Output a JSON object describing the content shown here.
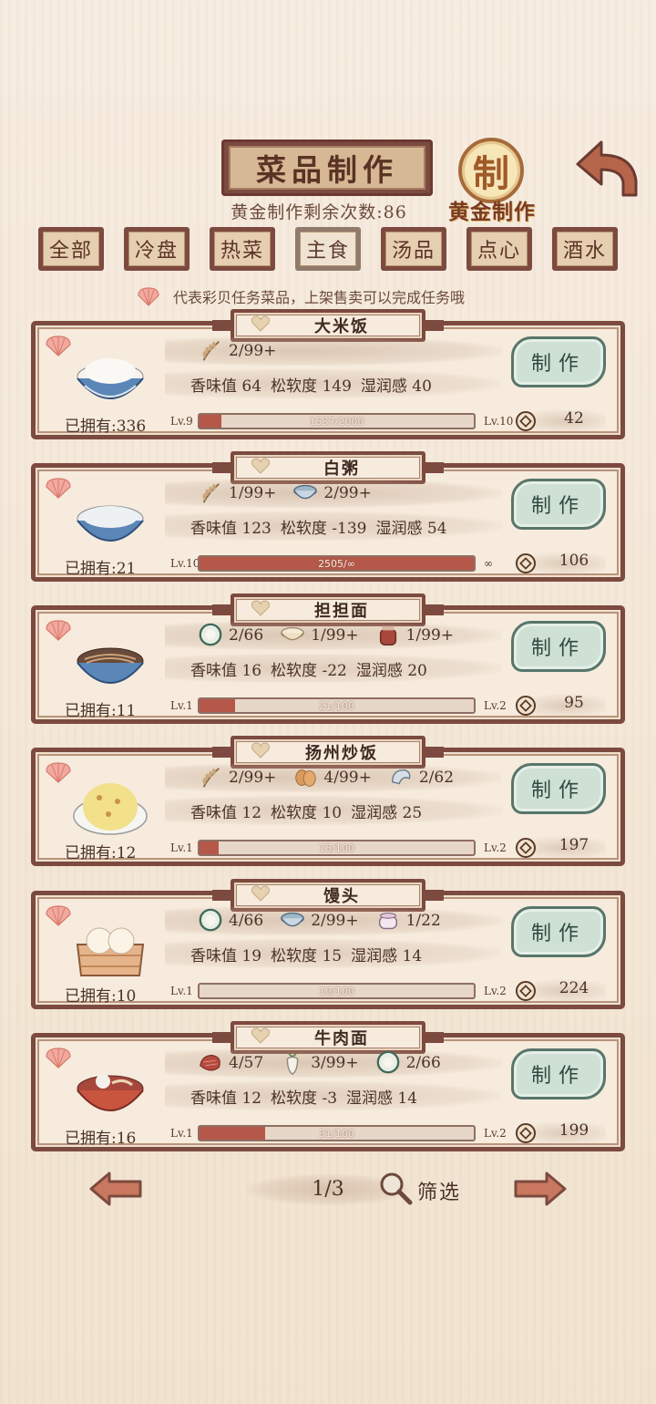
{
  "header": {
    "title": "菜品制作",
    "gold_count": "黄金制作剩余次数:86",
    "gold_seal_char": "制",
    "gold_label": "黄金制作"
  },
  "tabs": [
    {
      "label": "全部",
      "active": false
    },
    {
      "label": "冷盘",
      "active": false
    },
    {
      "label": "热菜",
      "active": false
    },
    {
      "label": "主食",
      "active": true
    },
    {
      "label": "汤品",
      "active": false
    },
    {
      "label": "点心",
      "active": false
    },
    {
      "label": "酒水",
      "active": false
    }
  ],
  "hint": "代表彩贝任务菜品，上架售卖可以完成任务哦",
  "make_label": "制作",
  "dishes": [
    {
      "name": "大米饭",
      "owned": "已拥有:336",
      "ingredients": [
        {
          "icon": "rice-stalk-icon",
          "count": "2/99+"
        }
      ],
      "stats": [
        "香味值 64",
        "松软度 149",
        "湿润感 40"
      ],
      "lv_left": "Lv.9",
      "lv_right": "Lv.10",
      "progress_text": "1537/2000",
      "progress": 0.077,
      "price": "42",
      "dish_icon": "rice-bowl-icon"
    },
    {
      "name": "白粥",
      "owned": "已拥有:21",
      "ingredients": [
        {
          "icon": "rice-stalk-icon",
          "count": "1/99+"
        },
        {
          "icon": "water-bowl-icon",
          "count": "2/99+"
        }
      ],
      "stats": [
        "香味值 123",
        "松软度 -139",
        "湿润感 54"
      ],
      "lv_left": "Lv.10",
      "lv_right": "∞",
      "progress_text": "2505/∞",
      "progress": 1.0,
      "price": "106",
      "dish_icon": "porridge-bowl-icon"
    },
    {
      "name": "担担面",
      "owned": "已拥有:11",
      "ingredients": [
        {
          "icon": "dough-plate-icon",
          "count": "2/66"
        },
        {
          "icon": "flour-bowl-icon",
          "count": "1/99+"
        },
        {
          "icon": "chili-jar-icon",
          "count": "1/99+"
        }
      ],
      "stats": [
        "香味值 16",
        "松软度 -22",
        "湿润感 20"
      ],
      "lv_left": "Lv.1",
      "lv_right": "Lv.2",
      "progress_text": "21/100",
      "progress": 0.13,
      "price": "95",
      "dish_icon": "noodle-bowl-icon"
    },
    {
      "name": "扬州炒饭",
      "owned": "已拥有:12",
      "ingredients": [
        {
          "icon": "rice-stalk-icon",
          "count": "2/99+"
        },
        {
          "icon": "egg-icon",
          "count": "4/99+"
        },
        {
          "icon": "shrimp-icon",
          "count": "2/62"
        }
      ],
      "stats": [
        "香味值 12",
        "松软度 10",
        "湿润感 25"
      ],
      "lv_left": "Lv.1",
      "lv_right": "Lv.2",
      "progress_text": "15/100",
      "progress": 0.07,
      "price": "197",
      "dish_icon": "fried-rice-plate-icon"
    },
    {
      "name": "馒头",
      "owned": "已拥有:10",
      "ingredients": [
        {
          "icon": "dough-plate-icon",
          "count": "4/66"
        },
        {
          "icon": "water-bowl-icon",
          "count": "2/99+"
        },
        {
          "icon": "sugar-jar-icon",
          "count": "1/22"
        }
      ],
      "stats": [
        "香味值 19",
        "松软度 15",
        "湿润感 14"
      ],
      "lv_left": "Lv.1",
      "lv_right": "Lv.2",
      "progress_text": "10/100",
      "progress": 0.0,
      "price": "224",
      "dish_icon": "steamed-bun-basket-icon"
    },
    {
      "name": "牛肉面",
      "owned": "已拥有:16",
      "ingredients": [
        {
          "icon": "beef-icon",
          "count": "4/57"
        },
        {
          "icon": "radish-icon",
          "count": "3/99+"
        },
        {
          "icon": "dough-plate-icon",
          "count": "2/66"
        }
      ],
      "stats": [
        "香味值 12",
        "松软度 -3",
        "湿润感 14"
      ],
      "lv_left": "Lv.1",
      "lv_right": "Lv.2",
      "progress_text": "31/100",
      "progress": 0.24,
      "price": "199",
      "dish_icon": "beef-noodle-bowl-icon"
    }
  ],
  "pagination": {
    "page": "1/3",
    "filter_label": "筛选"
  },
  "colors": {
    "frame": "#7d4a3f",
    "progress_fill": "#b5584a",
    "make_button": "#cfe0d4"
  }
}
